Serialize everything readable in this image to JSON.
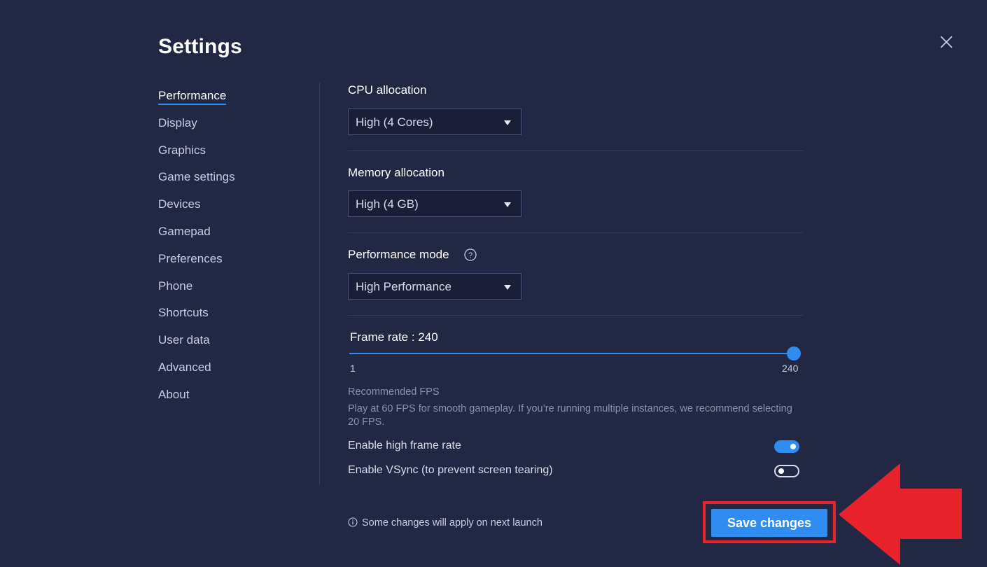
{
  "window": {
    "title": "Settings"
  },
  "sidebar": {
    "items": [
      {
        "label": "Performance",
        "active": true
      },
      {
        "label": "Display"
      },
      {
        "label": "Graphics"
      },
      {
        "label": "Game settings"
      },
      {
        "label": "Devices"
      },
      {
        "label": "Gamepad"
      },
      {
        "label": "Preferences"
      },
      {
        "label": "Phone"
      },
      {
        "label": "Shortcuts"
      },
      {
        "label": "User data"
      },
      {
        "label": "Advanced"
      },
      {
        "label": "About"
      }
    ]
  },
  "performance": {
    "cpu": {
      "label": "CPU allocation",
      "value": "High (4 Cores)"
    },
    "memory": {
      "label": "Memory allocation",
      "value": "High (4 GB)"
    },
    "mode": {
      "label": "Performance mode",
      "value": "High Performance",
      "help_icon": "question-circle-icon"
    },
    "frame_rate": {
      "label": "Frame rate : 240",
      "min": "1",
      "max": "240",
      "value": 240
    },
    "recommended": {
      "title": "Recommended FPS",
      "text": "Play at 60 FPS for smooth gameplay. If you’re running multiple instances, we recommend selecting 20 FPS."
    },
    "toggles": {
      "high_frame_rate": {
        "label": "Enable high frame rate",
        "on": true
      },
      "vsync": {
        "label": "Enable VSync (to prevent screen tearing)",
        "on": false
      }
    }
  },
  "footer": {
    "notice": "Some changes will apply on next launch",
    "notice_icon": "info-circle-icon",
    "save_label": "Save changes"
  },
  "colors": {
    "background": "#222743",
    "accent": "#2f8cf0",
    "annotation": "#e8232b"
  }
}
